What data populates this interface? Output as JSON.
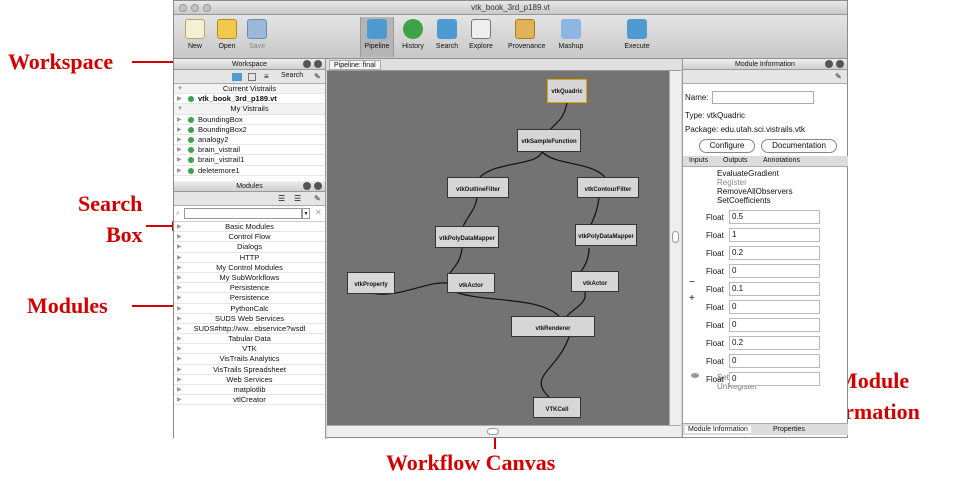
{
  "window": {
    "title": "vtk_book_3rd_p189.vt"
  },
  "toolbar": {
    "new": "New",
    "open": "Open",
    "save": "Save",
    "pipeline": "Pipeline",
    "history": "History",
    "search": "Search",
    "explore": "Explore",
    "provenance": "Provenance",
    "mashup": "Mashup",
    "execute": "Execute"
  },
  "workspace": {
    "title": "Workspace",
    "search_label": "Search",
    "items": [
      {
        "label": "Current Vistrails",
        "type": "header"
      },
      {
        "label": "vtk_book_3rd_p189.vt",
        "type": "bold"
      },
      {
        "label": "My Vistrails",
        "type": "header"
      },
      {
        "label": "BoundingBox",
        "type": "item"
      },
      {
        "label": "BoundingBox2",
        "type": "item"
      },
      {
        "label": "analogy2",
        "type": "item"
      },
      {
        "label": "brain_vistrail",
        "type": "item"
      },
      {
        "label": "brain_vistrail1",
        "type": "item"
      },
      {
        "label": "deletemore1",
        "type": "item"
      }
    ]
  },
  "modules": {
    "title": "Modules",
    "search_placeholder": "",
    "items": [
      "Basic Modules",
      "Control Flow",
      "Dialogs",
      "HTTP",
      "My Control Modules",
      "My SubWorkflows",
      "Persistence",
      "Persistence",
      "PythonCalc",
      "SUDS Web Services",
      "SUDS#http://ww...ebservice?wsdl",
      "Tabular Data",
      "VTK",
      "VisTrails Analytics",
      "VisTrails Spreadsheet",
      "Web Services",
      "matplotlib",
      "vtlCreator"
    ]
  },
  "canvas": {
    "tab": "Pipeline: final",
    "nodes": [
      "vtkQuadric",
      "vtkSampleFunction",
      "vtkOutlineFilter",
      "vtkContourFilter",
      "vtkPolyDataMapper",
      "vtkPolyDataMapper",
      "vtkProperty",
      "vtkActor",
      "vtkActor",
      "vtkRenderer",
      "VTKCell"
    ]
  },
  "module_info": {
    "title": "Module Information",
    "name_label": "Name:",
    "name_value": "",
    "type": "Type: vtkQuadric",
    "package": "Package: edu.utah.sci.vistrails.vtk",
    "configure": "Configure",
    "documentation": "Documentation",
    "tabs": [
      "Inputs",
      "Outputs",
      "Annotations"
    ],
    "methods_top": [
      "EvaluateGradient",
      "Register",
      "RemoveAllObservers",
      "SetCoefficients"
    ],
    "fields": [
      {
        "label": "Float",
        "value": "0.5"
      },
      {
        "label": "Float",
        "value": "1"
      },
      {
        "label": "Float",
        "value": "0.2"
      },
      {
        "label": "Float",
        "value": "0"
      },
      {
        "label": "Float",
        "value": "0.1"
      },
      {
        "label": "Float",
        "value": "0"
      },
      {
        "label": "Float",
        "value": "0"
      },
      {
        "label": "Float",
        "value": "0.2"
      },
      {
        "label": "Float",
        "value": "0"
      },
      {
        "label": "Float",
        "value": "0"
      }
    ],
    "methods_bottom": [
      "SetTransform",
      "UnRegister"
    ],
    "bottom_tabs": [
      "Module Information",
      "Properties"
    ],
    "minus": "−",
    "plus": "+"
  },
  "callouts": {
    "workspace": "Workspace",
    "search": "Search",
    "box": "Box",
    "modules": "Modules",
    "workflow_canvas": "Workflow Canvas",
    "module": "Module",
    "information": "Information"
  }
}
